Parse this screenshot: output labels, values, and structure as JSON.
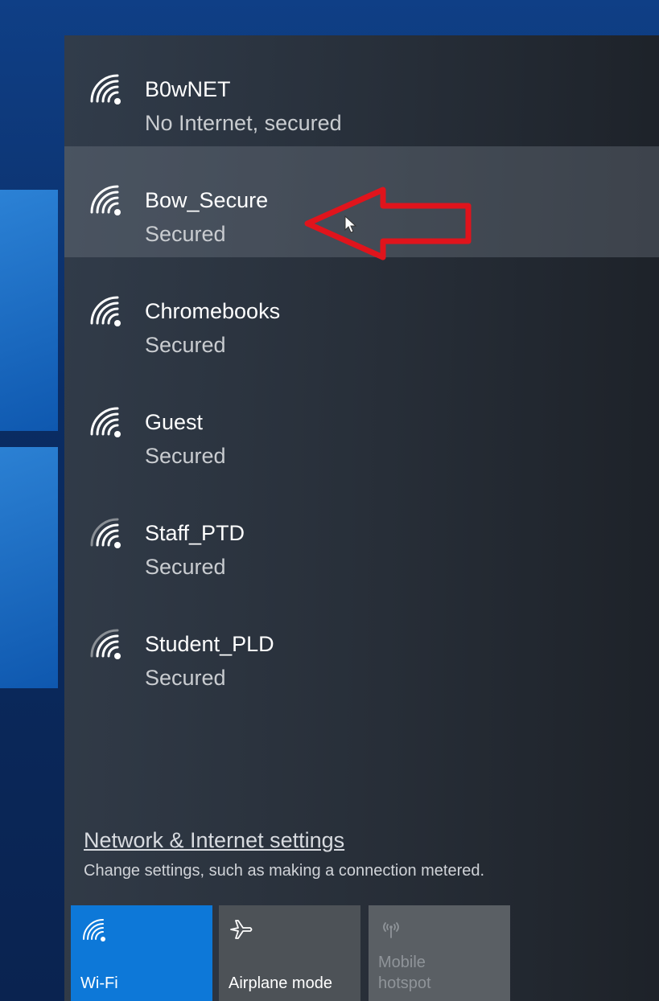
{
  "networks": [
    {
      "name": "B0wNET",
      "status": "No Internet, secured",
      "selected": false
    },
    {
      "name": "Bow_Secure",
      "status": "Secured",
      "selected": true
    },
    {
      "name": "Chromebooks",
      "status": "Secured",
      "selected": false
    },
    {
      "name": "Guest",
      "status": "Secured",
      "selected": false
    },
    {
      "name": "Staff_PTD",
      "status": "Secured",
      "selected": false
    },
    {
      "name": "Student_PLD",
      "status": "Secured",
      "selected": false
    }
  ],
  "settings": {
    "link_label": "Network & Internet settings",
    "description": "Change settings, such as making a connection metered."
  },
  "quick_actions": {
    "wifi": {
      "label": "Wi-Fi",
      "icon": "wifi-icon",
      "active": true
    },
    "airplane": {
      "label": "Airplane mode",
      "icon": "airplane-icon",
      "active": false
    },
    "hotspot": {
      "label_line1": "Mobile",
      "label_line2": "hotspot",
      "icon": "hotspot-icon",
      "disabled": true
    }
  },
  "colors": {
    "accent": "#0d78d8",
    "annotation_arrow": "#e0141c",
    "flyout_bg": "#2f353c"
  }
}
